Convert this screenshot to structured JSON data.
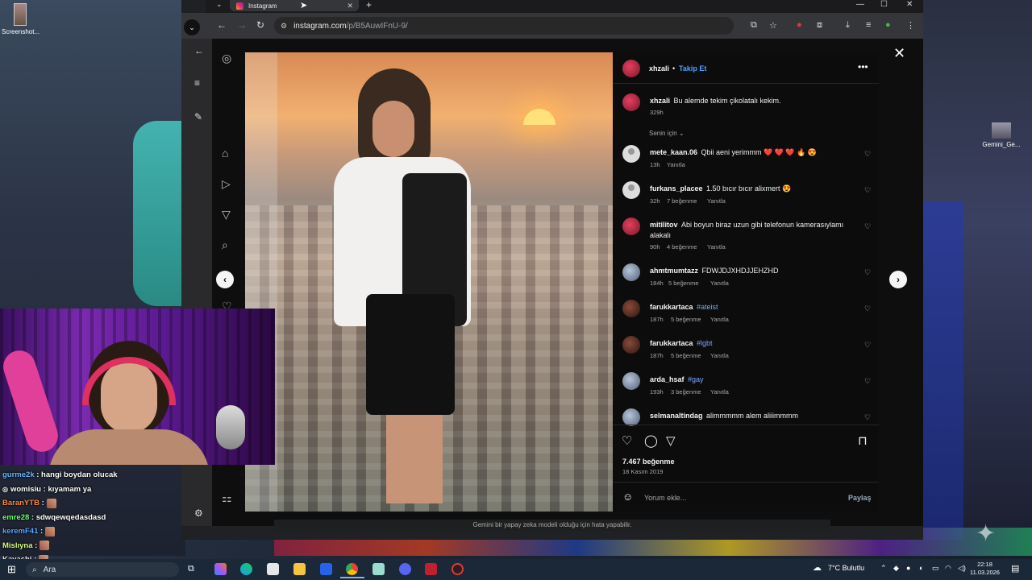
{
  "desktop": {
    "icons": [
      {
        "label": "Screenshot..."
      },
      {
        "label": "Gemini_Ge..."
      }
    ]
  },
  "browser": {
    "tab_title": "Instagram",
    "url_host": "instagram.com",
    "url_path": "/p/B5AuwIFnU-9/"
  },
  "post": {
    "author": "xhzali",
    "follow_label": "Takip Et",
    "caption_user": "xhzali",
    "caption_text": "Bu alemde tekim çikolatalı kekim.",
    "caption_time": "329h",
    "filter_label": "Senin için",
    "comments": [
      {
        "user": "mete_kaan.06",
        "text": "Qbii aeni yerimmm ❤️ ❤️ ❤️ 🔥 😍",
        "time": "13h",
        "likes": "",
        "reply": "Yanıtla",
        "avatar": "gray"
      },
      {
        "user": "furkans_placee",
        "text": "1.50 bıcır bıcır alixmert 😍",
        "time": "32h",
        "likes": "7 beğenme",
        "reply": "Yanıtla",
        "avatar": "gray"
      },
      {
        "user": "mitilitov",
        "text": "Abi boyun biraz uzun gibi telefonun kamerasıylamı alakalı",
        "time": "90h",
        "likes": "4 beğenme",
        "reply": "Yanıtla",
        "avatar": "red"
      },
      {
        "user": "ahmtmumtazz",
        "text": "FDWJDJXHDJJEHZHD",
        "time": "184h",
        "likes": "5 beğenme",
        "reply": "Yanıtla",
        "avatar": "light"
      },
      {
        "user": "farukkartaca",
        "text": "#ateist",
        "time": "187h",
        "likes": "5 beğenme",
        "reply": "Yanıtla",
        "avatar": "dark",
        "is_tag": true
      },
      {
        "user": "farukkartaca",
        "text": "#lgbt",
        "time": "187h",
        "likes": "5 beğenme",
        "reply": "Yanıtla",
        "avatar": "dark",
        "is_tag": true
      },
      {
        "user": "arda_hsaf",
        "text": "#gay",
        "time": "193h",
        "likes": "3 beğenme",
        "reply": "Yanıtla",
        "avatar": "light",
        "is_tag": true
      },
      {
        "user": "selmanaltindag",
        "text": "alimmmmm alem aliiimmmm",
        "time": "",
        "likes": "",
        "reply": "",
        "avatar": "light"
      }
    ],
    "likes_count": "7.467 beğenme",
    "date": "18 Kasım 2019",
    "comment_placeholder": "Yorum ekle...",
    "share_label": "Paylaş"
  },
  "chat": [
    {
      "user": "gurme2k",
      "text": ": hangi boydan olucak",
      "cls": "c-gurme",
      "emote": false
    },
    {
      "user": "womisiu",
      "text": ": kıyamam ya",
      "cls": "c-womisiu",
      "emote": false
    },
    {
      "user": "BaranYTB",
      "text": ":",
      "cls": "c-baran",
      "emote": true
    },
    {
      "user": "emre28",
      "text": ": sdwqewqedasdasd",
      "cls": "c-emre",
      "emote": false
    },
    {
      "user": "keremF41",
      "text": ":",
      "cls": "c-kerem",
      "emote": true
    },
    {
      "user": "Mislıyna",
      "text": ":",
      "cls": "c-misl",
      "emote": true
    },
    {
      "user": "Kavashi",
      "text": ":",
      "cls": "c-kava",
      "emote": true
    }
  ],
  "gemini_notice": "Gemini bir yapay zeka modeli olduğu için hata yapabilir.",
  "taskbar": {
    "search_placeholder": "Ara",
    "weather": "7°C  Bulutlu",
    "time": "22:18",
    "date": "11.03.2026"
  }
}
